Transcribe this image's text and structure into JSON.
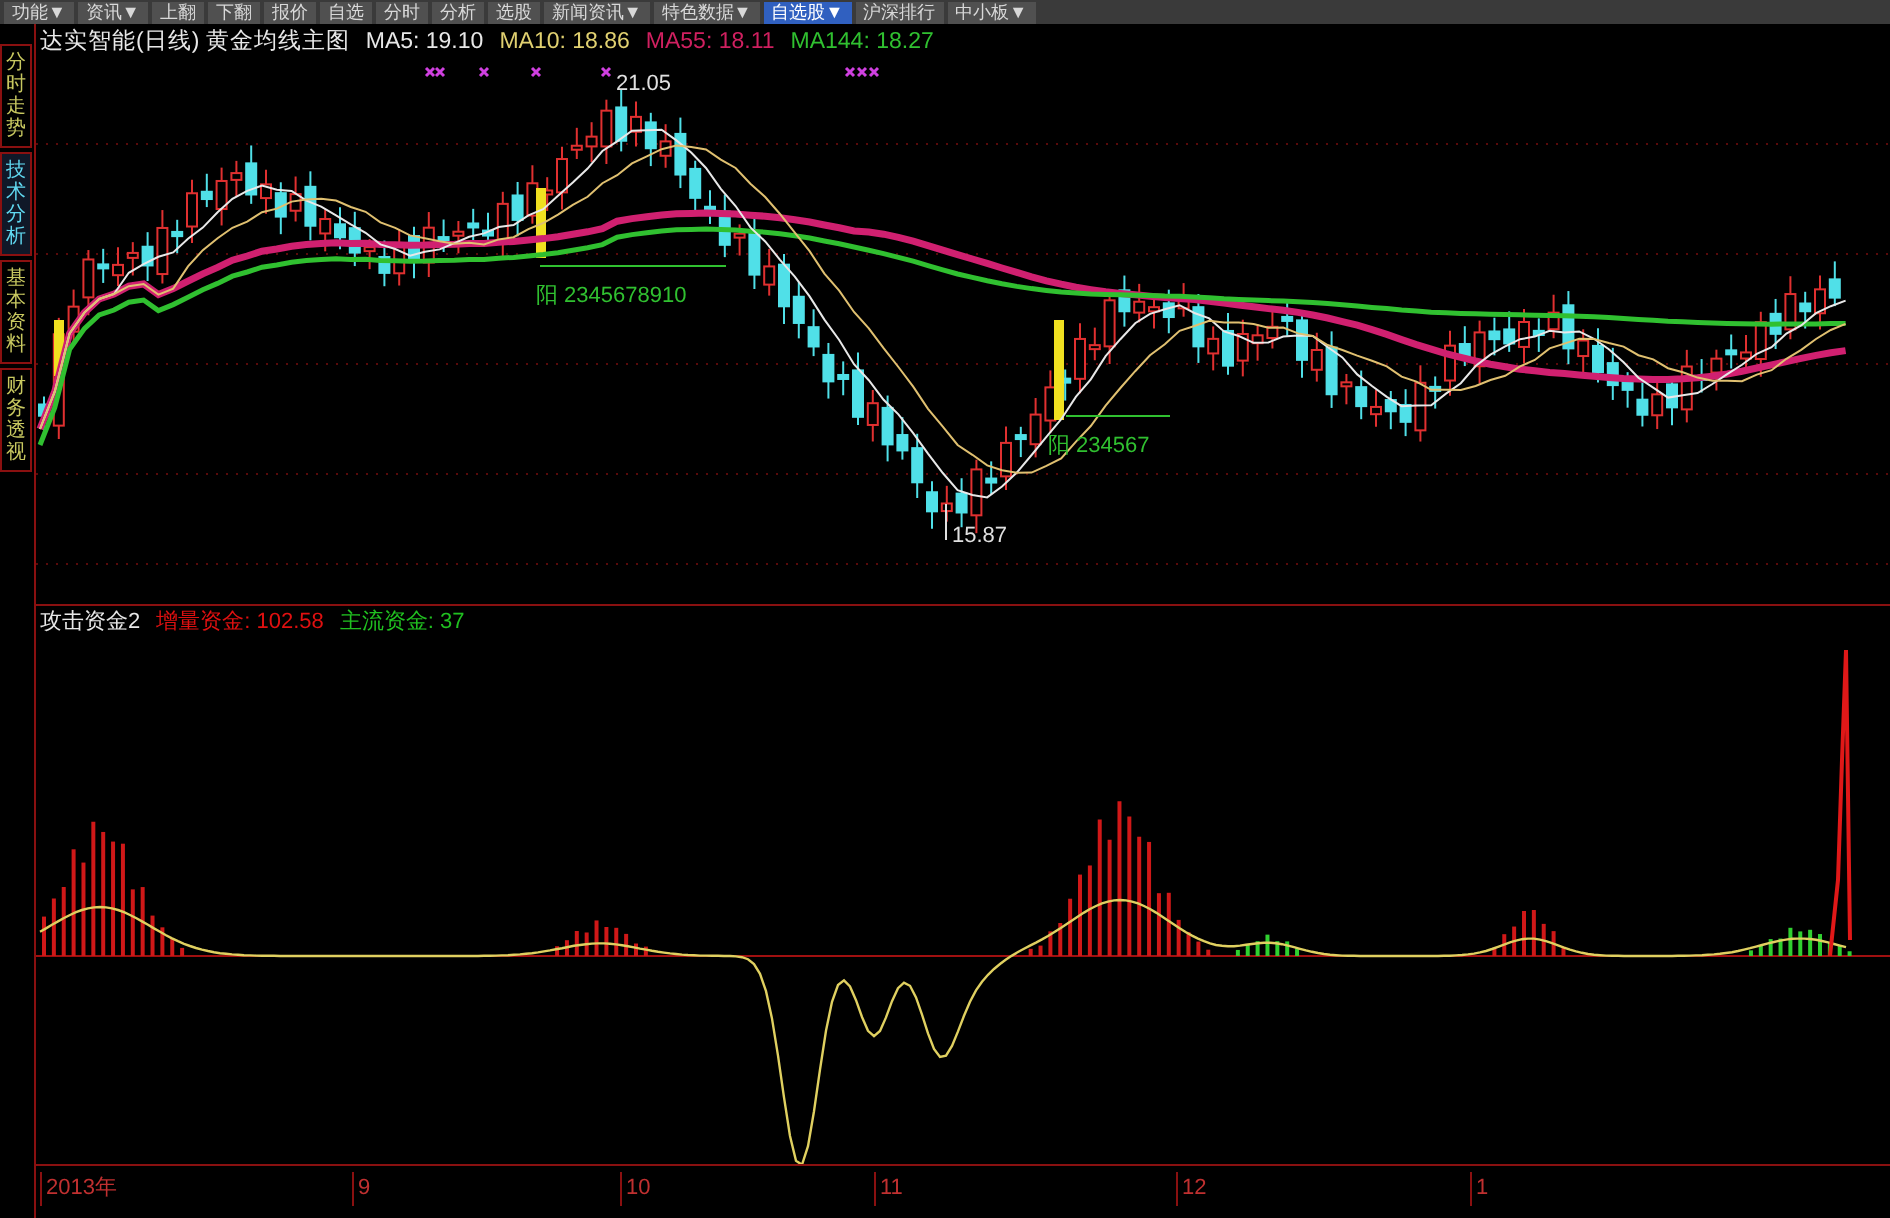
{
  "toolbar": [
    {
      "label": "功能▼",
      "selected": false
    },
    {
      "label": "资讯▼",
      "selected": false
    },
    {
      "label": "上翻",
      "selected": false
    },
    {
      "label": "下翻",
      "selected": false
    },
    {
      "label": "报价",
      "selected": false
    },
    {
      "label": "自选",
      "selected": false
    },
    {
      "label": "分时",
      "selected": false
    },
    {
      "label": "分析",
      "selected": false
    },
    {
      "label": "选股",
      "selected": false
    },
    {
      "label": "新闻资讯▼",
      "selected": false
    },
    {
      "label": "特色数据▼",
      "selected": false
    },
    {
      "label": "自选股▼",
      "selected": true
    },
    {
      "label": "沪深排行",
      "selected": false
    },
    {
      "label": "中小板▼",
      "selected": false
    }
  ],
  "sidebar_tabs": [
    {
      "label": "分时走势",
      "selected": false
    },
    {
      "label": "技术分析",
      "selected": true
    },
    {
      "label": "基本资料",
      "selected": false
    },
    {
      "label": "财务透视",
      "selected": false
    }
  ],
  "price_panel": {
    "title": "达实智能(日线) 黄金均线主图",
    "indicators": [
      {
        "label": "MA5: 19.10",
        "color": "#e8e8e8"
      },
      {
        "label": "MA10: 18.86",
        "color": "#e0d070"
      },
      {
        "label": "MA55: 18.11",
        "color": "#d02060"
      },
      {
        "label": "MA144: 18.27",
        "color": "#30c030"
      }
    ],
    "high_label": "21.05",
    "low_label": "15.87",
    "annotations": [
      "阳 2345678910",
      "阳 234567"
    ]
  },
  "fund_panel": {
    "title": "攻击资金2",
    "indicators": [
      {
        "label": "增量资金: 102.58",
        "color": "#e01010"
      },
      {
        "label": "主流资金: 37",
        "color": "#20c020"
      }
    ]
  },
  "time_axis": [
    "2013年",
    "9",
    "10",
    "11",
    "12",
    "1"
  ]
}
